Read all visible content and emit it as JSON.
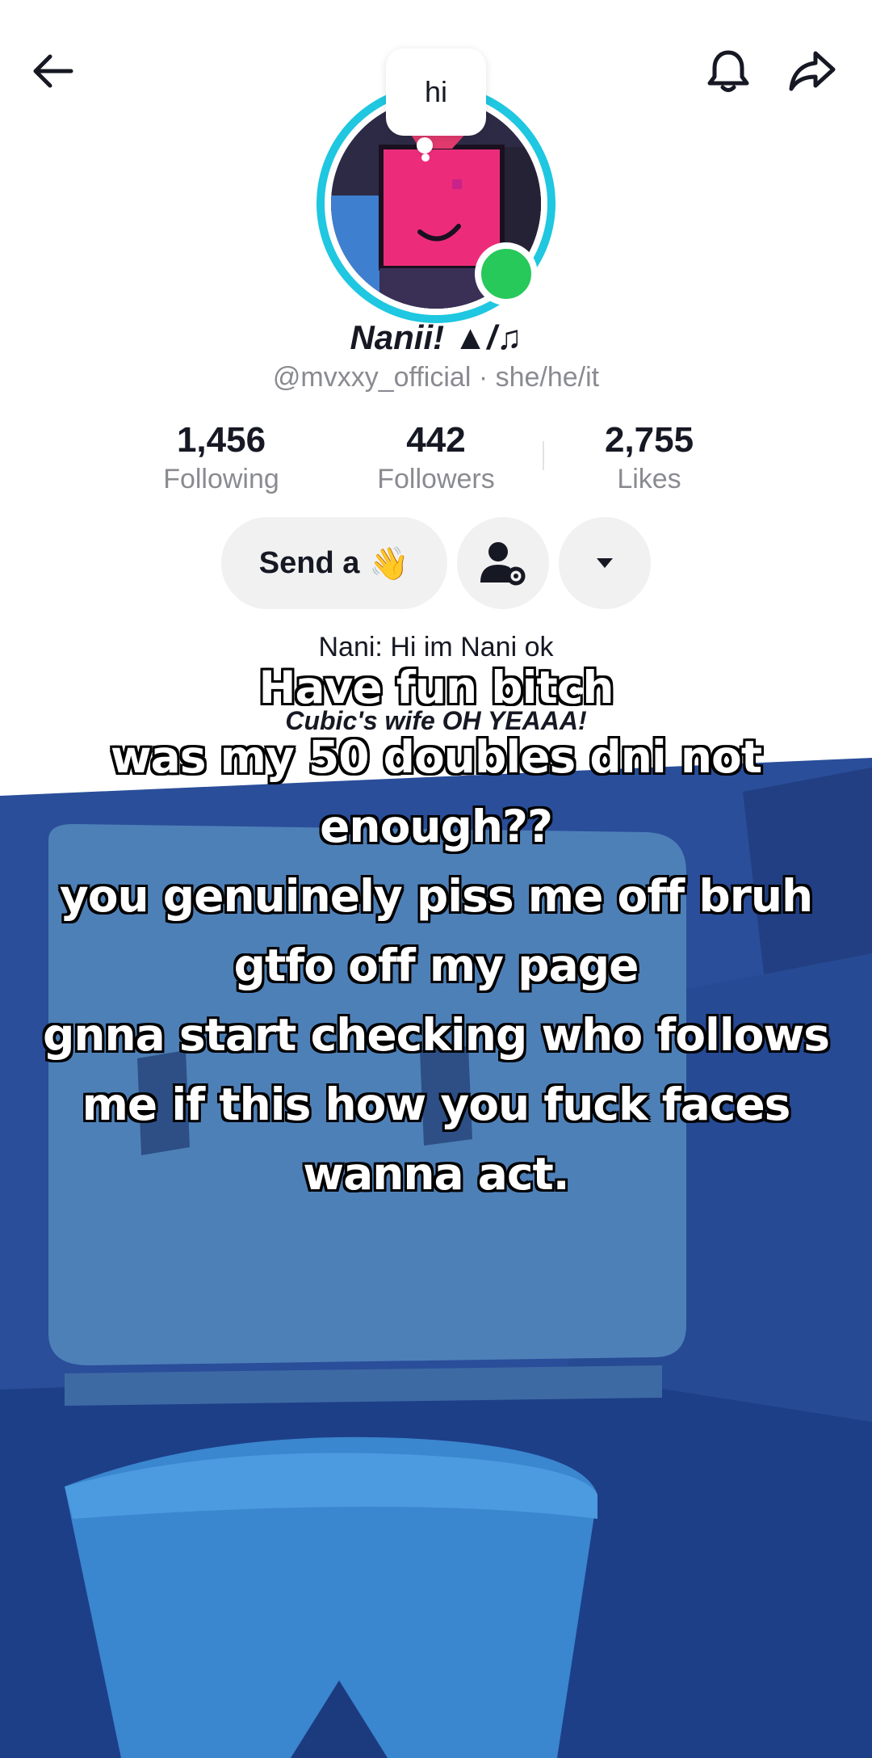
{
  "header": {
    "back_icon": "arrow-left-icon",
    "bell_icon": "bell-icon",
    "share_icon": "share-arrow-icon"
  },
  "profile": {
    "note": "hi",
    "display_name": "Nanii! ▲/♫",
    "handle": "@mvxxy_official · she/he/it",
    "stats": [
      {
        "value": "1,456",
        "label": "Following"
      },
      {
        "value": "442",
        "label": "Followers"
      },
      {
        "value": "2,755",
        "label": "Likes"
      }
    ],
    "send_button_label": "Send a",
    "send_button_emoji": "👋",
    "bio_line1": "Nani: Hi im Nani ok",
    "bio_line2": "Cubic's wife OH YEAAA!"
  },
  "caption": {
    "lines": [
      "Have fun bitch",
      "was my 50 doubles dni not",
      "enough??",
      "you genuinely piss me off bruh",
      "gtfo off my page",
      "gnna start checking who follows",
      "me if this how you fuck faces",
      "wanna act."
    ]
  },
  "colors": {
    "ring": "#1fc7e0",
    "online": "#27c95b",
    "background_blue": "#2a4e9a"
  }
}
